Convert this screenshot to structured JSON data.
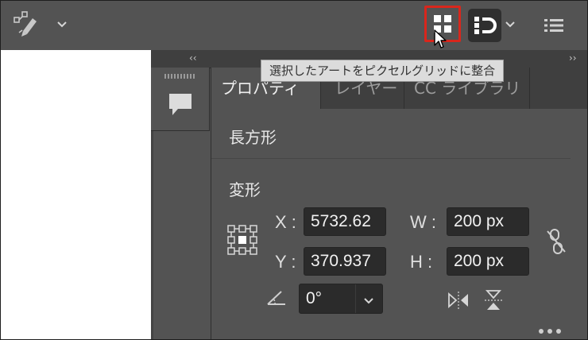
{
  "toolbar": {
    "tooltip": "選択したアートをピクセルグリッドに整合",
    "icons": [
      "pen-tool-icon",
      "chevron-down-icon",
      "align-to-pixel-grid-icon",
      "snap-icon",
      "list-icon"
    ]
  },
  "panel": {
    "tabs": [
      {
        "label": "プロパティ",
        "active": true
      },
      {
        "label": "レイヤー",
        "active": false
      },
      {
        "label": "CC ライブラリ",
        "active": false
      }
    ],
    "object_type": "長方形",
    "transform_title": "変形",
    "x_label": "X :",
    "x_value": "5732.62",
    "y_label": "Y :",
    "y_value": "370.937",
    "w_label": "W :",
    "w_value": "200 px",
    "h_label": "H :",
    "h_value": "200 px",
    "angle_value": "0°"
  },
  "colors": {
    "highlight": "#d9261c",
    "panel_bg": "#535353",
    "input_bg": "#2b2b2b"
  }
}
